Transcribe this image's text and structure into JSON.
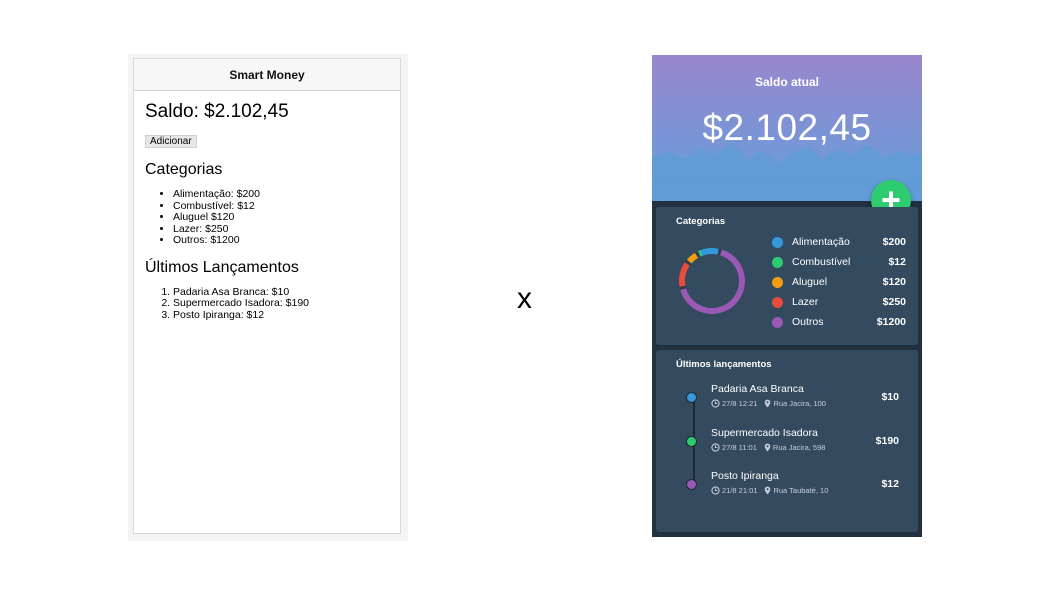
{
  "plain": {
    "header_title": "Smart Money",
    "balance": "Saldo: $2.102,45",
    "add_button": "Adicionar",
    "categories_heading": "Categorias",
    "categories": [
      "Alimentação: $200",
      "Combustível: $12",
      "Aluguel $120",
      "Lazer: $250",
      "Outros: $1200"
    ],
    "recent_heading": "Últimos Lançamentos",
    "recent": [
      "Padaria Asa Branca: $10",
      "Supermercado Isadora: $190",
      "Posto Ipiranga: $12"
    ]
  },
  "separator": "x",
  "styled": {
    "hero_label": "Saldo atual",
    "hero_amount": "$2.102,45",
    "add_icon": "plus-icon",
    "categories_title": "Categorias",
    "categories": [
      {
        "name": "Alimentação",
        "value": "$200",
        "color": "#3498db"
      },
      {
        "name": "Combustível",
        "value": "$12",
        "color": "#2ecc71"
      },
      {
        "name": "Aluguel",
        "value": "$120",
        "color": "#f39c12"
      },
      {
        "name": "Lazer",
        "value": "$250",
        "color": "#e74c3c"
      },
      {
        "name": "Outros",
        "value": "$1200",
        "color": "#9b59b6"
      }
    ],
    "recent_title": "Últimos lançamentos",
    "recent": [
      {
        "name": "Padaria Asa Branca",
        "time": "27/8 12:21",
        "place": "Rua Jacira, 100",
        "value": "$10",
        "color": "#3498db"
      },
      {
        "name": "Supermercado Isadora",
        "time": "27/8 11:01",
        "place": "Rua Jacira, 598",
        "value": "$190",
        "color": "#2ecc71"
      },
      {
        "name": "Posto Ipiranga",
        "time": "21/8 21:01",
        "place": "Rua Taubaté, 10",
        "value": "$12",
        "color": "#9b59b6"
      }
    ]
  }
}
